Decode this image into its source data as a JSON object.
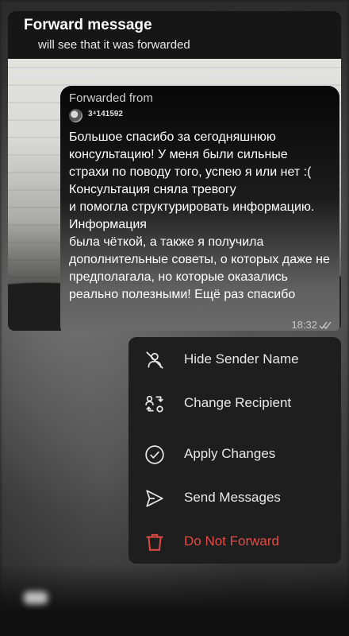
{
  "header": {
    "title": "Forward message",
    "subtitle": "will see that it was forwarded"
  },
  "message": {
    "forwarded_label": "Forwarded from",
    "sender": "3⁴141592",
    "text": "Большое спасибо за сегодняшнюю консультацию! У меня были сильные страхи по поводу того, успею я или нет :(\nКонсультация сняла тревогу\nи помогла структурировать информацию. Информация\nбыла чёткой, а также я получила дополнительные советы, о которых даже не предполагала, но которые оказались реально полезными! Ещё раз спасибо",
    "time": "18:32",
    "status_icon": "double-check-icon"
  },
  "menu": {
    "items": [
      {
        "label": "Hide Sender Name",
        "icon": "user-off-icon"
      },
      {
        "label": "Change Recipient",
        "icon": "swap-recipient-icon"
      },
      {
        "label": "Apply Changes",
        "icon": "check-circle-icon"
      },
      {
        "label": "Send Messages",
        "icon": "send-icon"
      },
      {
        "label": "Do Not Forward",
        "icon": "trash-icon",
        "color": "#e14b46"
      }
    ]
  }
}
